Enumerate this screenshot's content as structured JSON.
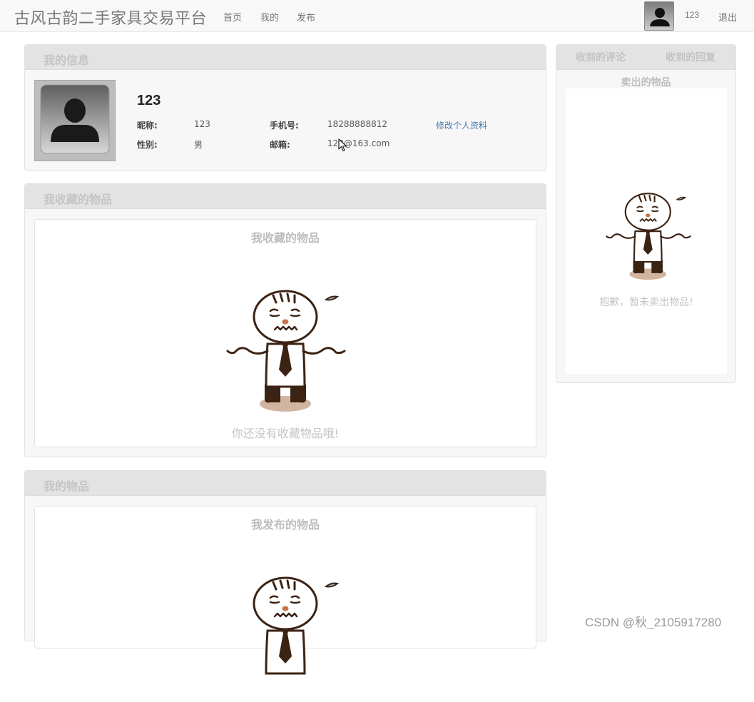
{
  "navbar": {
    "brand": "古风古韵二手家具交易平台",
    "links": [
      "首页",
      "我的",
      "发布"
    ],
    "username": "123",
    "logout": "退出",
    "avatar_icon": "user-silhouette-icon"
  },
  "profile_panel": {
    "title": "我的信息",
    "name": "123",
    "fields": {
      "nickname_label": "昵称:",
      "nickname_value": "123",
      "phone_label": "手机号:",
      "phone_value": "18288888812",
      "gender_label": "性别:",
      "gender_value": "男",
      "email_label": "邮箱:",
      "email_value": "123@163.com"
    },
    "edit_link": "修改个人资料"
  },
  "favorites_panel": {
    "title": "我收藏的物品",
    "box_title": "我收藏的物品",
    "empty_message": "你还没有收藏物品哦!"
  },
  "my_items_panel": {
    "title": "我的物品",
    "box_title": "我发布的物品"
  },
  "side_panel": {
    "tabs": [
      "收到的评论",
      "收到的回复"
    ],
    "box_title": "卖出的物品",
    "empty_message": "抱歉，暂未卖出物品!"
  },
  "watermark": "CSDN @秋_2105917280",
  "colors": {
    "navbar_bg": "#f8f8f8",
    "panel_header": "#e3e3e3",
    "link_blue": "#4a78b0",
    "figure_brown": "#3b2314",
    "shadow_tan": "#d2b5a0"
  }
}
